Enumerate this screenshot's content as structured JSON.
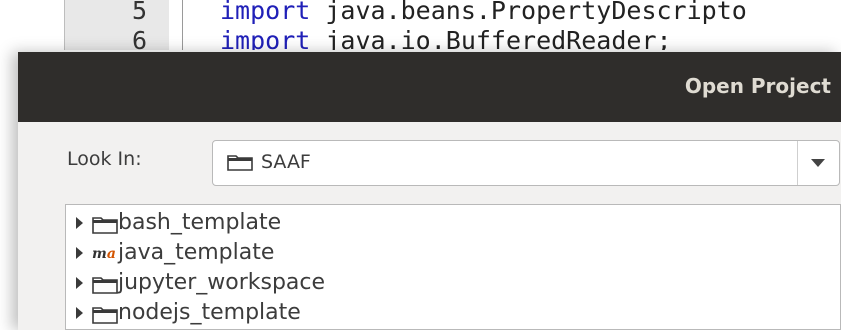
{
  "editor": {
    "lines": [
      {
        "number": "5",
        "keyword": "import",
        "rest": " java.beans.PropertyDescripto"
      },
      {
        "number": "6",
        "keyword": "import",
        "rest": " java.io.BufferedReader;"
      }
    ]
  },
  "dialog": {
    "title": "Open Project",
    "look_in": {
      "label": "Look In:",
      "value": "SAAF",
      "icon": "folder-icon"
    },
    "tree": {
      "items": [
        {
          "label": "bash_template",
          "icon": "folder-icon"
        },
        {
          "label": "java_template",
          "icon": "maven-project-icon"
        },
        {
          "label": "jupyter_workspace",
          "icon": "folder-icon"
        },
        {
          "label": "nodejs_template",
          "icon": "folder-icon"
        }
      ]
    }
  },
  "colors": {
    "titlebar": "#2f2d2b",
    "title_text": "#dfdbd2",
    "dialog_bg": "#f2f1f0",
    "keyword": "#2020b8"
  }
}
